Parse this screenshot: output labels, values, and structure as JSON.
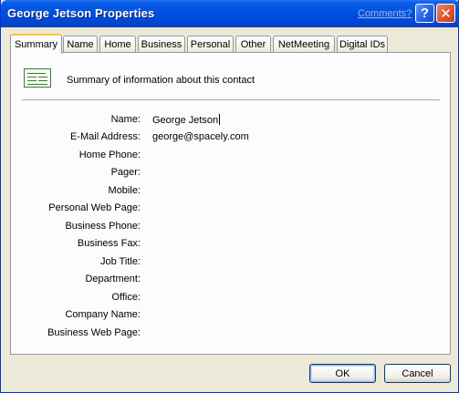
{
  "window": {
    "title": "George Jetson Properties",
    "comments_link": "Comments?",
    "help_glyph": "?",
    "close_glyph": "✕"
  },
  "tabs": [
    {
      "label": "Summary",
      "active": true
    },
    {
      "label": "Name",
      "active": false
    },
    {
      "label": "Home",
      "active": false
    },
    {
      "label": "Business",
      "active": false
    },
    {
      "label": "Personal",
      "active": false
    },
    {
      "label": "Other",
      "active": false
    },
    {
      "label": "NetMeeting",
      "active": false
    },
    {
      "label": "Digital IDs",
      "active": false
    }
  ],
  "summary": {
    "icon": "contact-card-icon",
    "header": "Summary of information about this contact",
    "fields": [
      {
        "label": "Name:",
        "value": "George Jetson"
      },
      {
        "label": "E-Mail Address:",
        "value": "george@spacely.com"
      },
      {
        "label": "Home Phone:",
        "value": ""
      },
      {
        "label": "Pager:",
        "value": ""
      },
      {
        "label": "Mobile:",
        "value": ""
      },
      {
        "label": "Personal Web Page:",
        "value": ""
      },
      {
        "label": "Business Phone:",
        "value": ""
      },
      {
        "label": "Business Fax:",
        "value": ""
      },
      {
        "label": "Job Title:",
        "value": ""
      },
      {
        "label": "Department:",
        "value": ""
      },
      {
        "label": "Office:",
        "value": ""
      },
      {
        "label": "Company Name:",
        "value": ""
      },
      {
        "label": "Business Web Page:",
        "value": ""
      }
    ]
  },
  "buttons": {
    "ok": "OK",
    "cancel": "Cancel"
  }
}
